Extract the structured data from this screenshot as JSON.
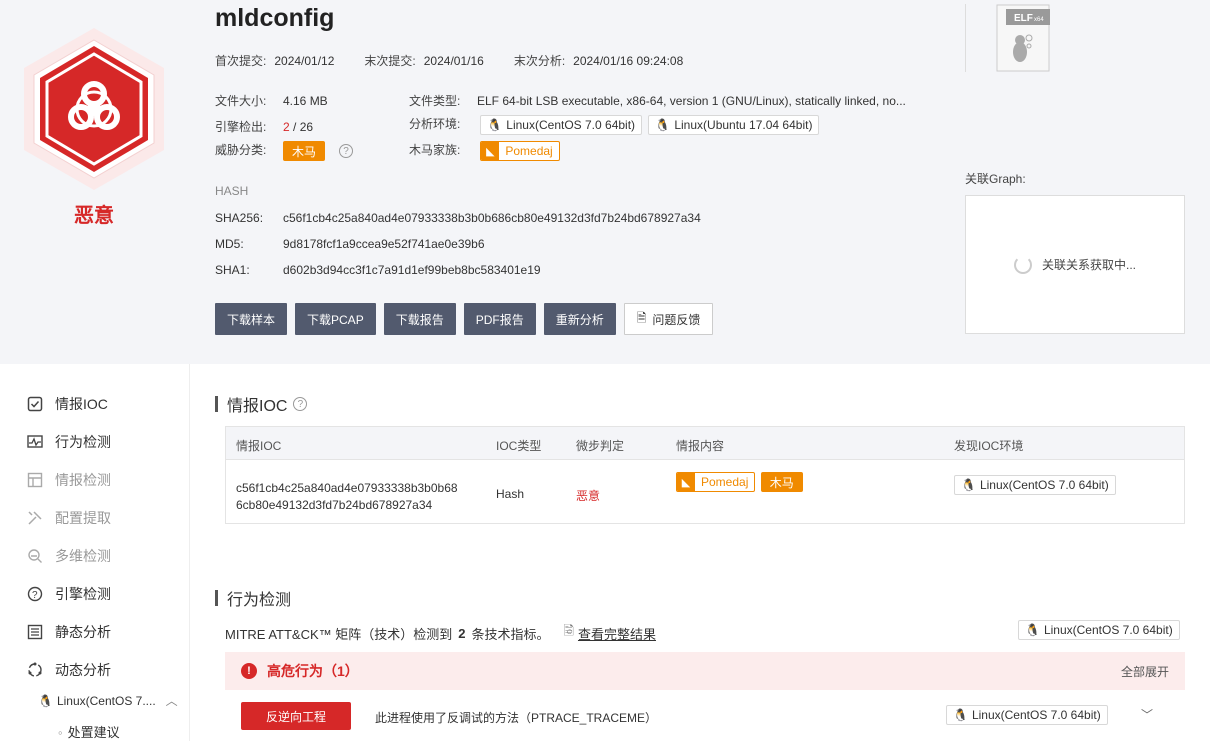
{
  "header": {
    "title": "mldconfig",
    "verdict": "恶意",
    "dates": [
      {
        "label": "首次提交:",
        "value": "2024/01/12"
      },
      {
        "label": "末次提交:",
        "value": "2024/01/16"
      },
      {
        "label": "末次分析:",
        "value": "2024/01/16 09:24:08"
      }
    ],
    "file_size": {
      "label": "文件大小:",
      "value": "4.16 MB"
    },
    "engine": {
      "label": "引擎检出:",
      "detected": "2",
      "sep": " / ",
      "total": "26"
    },
    "threat": {
      "label": "威胁分类:",
      "value": "木马"
    },
    "file_type": {
      "label": "文件类型:",
      "value": "ELF 64-bit LSB executable, x86-64, version 1 (GNU/Linux), statically linked, no..."
    },
    "analysis_env": {
      "label": "分析环境:",
      "envs": [
        "Linux(CentOS 7.0 64bit)",
        "Linux(Ubuntu 17.04 64bit)"
      ]
    },
    "family": {
      "label": "木马家族:",
      "value": "Pomedaj"
    },
    "hash_title": "HASH",
    "hashes": [
      {
        "label": "SHA256:",
        "value": "c56f1cb4c25a840ad4e07933338b3b0b686cb80e49132d3fd7b24bd678927a34"
      },
      {
        "label": "MD5:",
        "value": "9d8178fcf1a9ccea9e52f741ae0e39b6"
      },
      {
        "label": "SHA1:",
        "value": "d602b3d94cc3f1c7a91d1ef99beb8bc583401e19"
      }
    ],
    "buttons": [
      "下载样本",
      "下载PCAP",
      "下载报告",
      "PDF报告",
      "重新分析"
    ],
    "feedback": "问题反馈",
    "file_badge": "ELF",
    "file_badge_sub": "x64",
    "graph_label": "关联Graph:",
    "graph_loading": "关联关系获取中..."
  },
  "sidebar": {
    "items": [
      {
        "label": "情报IOC",
        "icon": "checklist-icon"
      },
      {
        "label": "行为检测",
        "icon": "pulse-icon"
      },
      {
        "label": "情报检测",
        "icon": "layout-icon"
      },
      {
        "label": "配置提取",
        "icon": "tools-icon"
      },
      {
        "label": "多维检测",
        "icon": "search-layers-icon"
      },
      {
        "label": "引擎检测",
        "icon": "question-circle-icon"
      },
      {
        "label": "静态分析",
        "icon": "list-icon"
      },
      {
        "label": "动态分析",
        "icon": "cycle-icon"
      }
    ],
    "sub_env": "Linux(CentOS 7....",
    "sub_item": "处置建议"
  },
  "ioc": {
    "title": "情报IOC",
    "columns": [
      "情报IOC",
      "IOC类型",
      "微步判定",
      "情报内容",
      "发现IOC环境"
    ],
    "row": {
      "ioc_line1": "c56f1cb4c25a840ad4e07933338b3b0b68",
      "ioc_line2": "6cb80e49132d3fd7b24bd678927a34",
      "type": "Hash",
      "verdict": "恶意",
      "family": "Pomedaj",
      "category": "木马",
      "env": "Linux(CentOS 7.0 64bit)"
    }
  },
  "behavior": {
    "title": "行为检测",
    "summary_pre": "MITRE ATT&CK™ 矩阵（技术）检测到",
    "count": "2",
    "summary_post": "条技术指标。",
    "full_link": "查看完整结果",
    "env": "Linux(CentOS 7.0 64bit)",
    "risk_title": "高危行为（1）",
    "expand_all": "全部展开",
    "tactic": "反逆向工程",
    "description": "此进程使用了反调试的方法（PTRACE_TRACEME）",
    "row_env": "Linux(CentOS 7.0 64bit)"
  },
  "colors": {
    "malicious": "#d62828",
    "trojan": "#f08a00",
    "button": "#525a6e"
  }
}
